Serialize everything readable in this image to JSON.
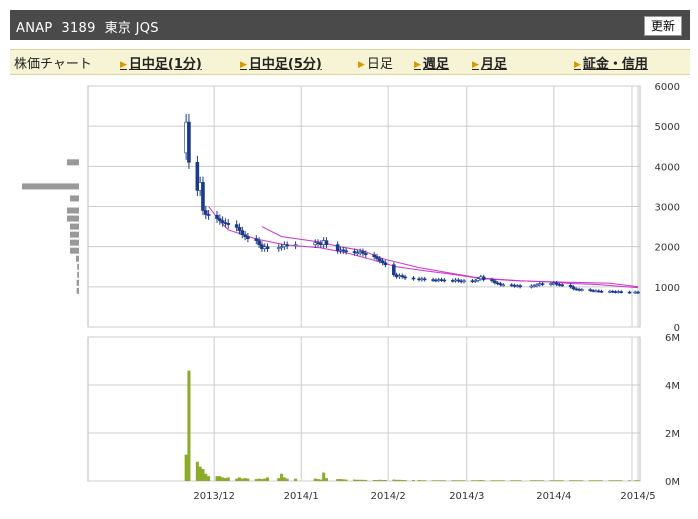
{
  "header": {
    "title": "ANAP  3189  東京 JQS",
    "refresh_label": "更新"
  },
  "nav": {
    "items": [
      {
        "label": "株価チャート",
        "link": false,
        "arrow": false
      },
      {
        "label": "日中足(1分)",
        "link": true,
        "arrow": true
      },
      {
        "label": "日中足(5分)",
        "link": true,
        "arrow": true
      },
      {
        "label": "日足",
        "link": false,
        "arrow": true
      },
      {
        "label": "週足",
        "link": true,
        "arrow": true
      },
      {
        "label": "月足",
        "link": true,
        "arrow": true
      },
      {
        "label": "証金・信用",
        "link": true,
        "arrow": true
      }
    ]
  },
  "colors": {
    "candle": "#1a3a8a",
    "ma": "#cc33cc",
    "volume": "#8aaa2a",
    "volume_profile": "#999999",
    "grid": "#cccccc"
  },
  "chart_data": [
    {
      "type": "candlestick",
      "ylim": [
        0,
        6000
      ],
      "yticks": [
        0,
        1000,
        2000,
        3000,
        4000,
        5000,
        6000
      ],
      "xticks": [
        "2013/12",
        "2014/1",
        "2014/2",
        "2014/3",
        "2014/4",
        "2014/5"
      ],
      "x_tick_dates": [
        "2013-12-01",
        "2014-01-01",
        "2014-02-01",
        "2014-03-01",
        "2014-04-01",
        "2014-05-01"
      ],
      "dates": [
        "2013-11-21",
        "2013-11-22",
        "2013-11-25",
        "2013-11-26",
        "2013-11-27",
        "2013-11-28",
        "2013-11-29",
        "2013-12-02",
        "2013-12-03",
        "2013-12-04",
        "2013-12-05",
        "2013-12-06",
        "2013-12-09",
        "2013-12-10",
        "2013-12-11",
        "2013-12-12",
        "2013-12-13",
        "2013-12-16",
        "2013-12-17",
        "2013-12-18",
        "2013-12-19",
        "2013-12-20",
        "2013-12-24",
        "2013-12-25",
        "2013-12-26",
        "2013-12-27",
        "2013-12-30",
        "2014-01-06",
        "2014-01-07",
        "2014-01-08",
        "2014-01-09",
        "2014-01-10",
        "2014-01-14",
        "2014-01-15",
        "2014-01-16",
        "2014-01-17",
        "2014-01-20",
        "2014-01-21",
        "2014-01-22",
        "2014-01-23",
        "2014-01-24",
        "2014-01-27",
        "2014-01-28",
        "2014-01-29",
        "2014-01-30",
        "2014-01-31",
        "2014-02-03",
        "2014-02-04",
        "2014-02-05",
        "2014-02-06",
        "2014-02-07",
        "2014-02-10",
        "2014-02-12",
        "2014-02-13",
        "2014-02-14",
        "2014-02-17",
        "2014-02-18",
        "2014-02-19",
        "2014-02-20",
        "2014-02-21",
        "2014-02-24",
        "2014-02-25",
        "2014-02-26",
        "2014-02-27",
        "2014-02-28",
        "2014-03-03",
        "2014-03-04",
        "2014-03-05",
        "2014-03-06",
        "2014-03-07",
        "2014-03-10",
        "2014-03-11",
        "2014-03-12",
        "2014-03-13",
        "2014-03-14",
        "2014-03-17",
        "2014-03-18",
        "2014-03-19",
        "2014-03-20",
        "2014-03-24",
        "2014-03-25",
        "2014-03-26",
        "2014-03-27",
        "2014-03-28",
        "2014-03-31",
        "2014-04-01",
        "2014-04-02",
        "2014-04-03",
        "2014-04-04",
        "2014-04-07",
        "2014-04-08",
        "2014-04-09",
        "2014-04-10",
        "2014-04-11",
        "2014-04-14",
        "2014-04-15",
        "2014-04-16",
        "2014-04-17",
        "2014-04-18",
        "2014-04-21",
        "2014-04-22",
        "2014-04-23",
        "2014-04-24",
        "2014-04-25",
        "2014-04-28",
        "2014-04-30",
        "2014-05-01"
      ],
      "close": [
        5100,
        4100,
        3400,
        3600,
        2900,
        2800,
        2780,
        2700,
        2650,
        2600,
        2580,
        2550,
        2480,
        2400,
        2300,
        2250,
        2200,
        2150,
        2050,
        1950,
        2000,
        1950,
        1980,
        2000,
        2050,
        2020,
        2050,
        2100,
        2080,
        2050,
        2150,
        2050,
        1900,
        1920,
        1900,
        1880,
        1850,
        1850,
        1880,
        1830,
        1800,
        1750,
        1700,
        1650,
        1600,
        1550,
        1300,
        1250,
        1280,
        1250,
        1220,
        1200,
        1180,
        1200,
        1180,
        1170,
        1160,
        1180,
        1170,
        1160,
        1150,
        1170,
        1150,
        1130,
        1150,
        1140,
        1160,
        1200,
        1250,
        1180,
        1150,
        1100,
        1080,
        1050,
        1050,
        1040,
        1020,
        1030,
        1000,
        1020,
        1030,
        1050,
        1080,
        1060,
        1080,
        1100,
        1060,
        1050,
        1040,
        1000,
        950,
        940,
        920,
        930,
        910,
        900,
        900,
        890,
        880,
        890,
        880,
        870,
        880,
        870,
        860,
        870,
        860
      ],
      "ma": {
        "name": "",
        "points": [
          [
            10,
            3000
          ],
          [
            15,
            2640
          ],
          [
            20,
            2420
          ],
          [
            30,
            2190
          ],
          [
            43,
            2050
          ],
          [
            53,
            1970
          ],
          [
            64,
            1850
          ],
          [
            75,
            1660
          ],
          [
            86,
            1500
          ],
          [
            97,
            1400
          ],
          [
            108,
            1310
          ],
          [
            118,
            1240
          ],
          [
            130,
            1190
          ],
          [
            141,
            1150
          ],
          [
            152,
            1120
          ],
          [
            163,
            1080
          ],
          [
            174,
            1060
          ],
          [
            183,
            1020
          ],
          [
            192,
            980
          ]
        ]
      },
      "ma_long": {
        "name": "",
        "points": [
          [
            34,
            2500
          ],
          [
            42,
            2250
          ],
          [
            50,
            2120
          ],
          [
            60,
            2000
          ],
          [
            70,
            1900
          ],
          [
            80,
            1700
          ],
          [
            95,
            1480
          ],
          [
            110,
            1320
          ],
          [
            125,
            1200
          ],
          [
            140,
            1150
          ],
          [
            155,
            1120
          ],
          [
            170,
            1100
          ],
          [
            180,
            1090
          ],
          [
            192,
            1000
          ]
        ]
      },
      "volume_profile": [
        {
          "price": 4100,
          "rel": 0.2
        },
        {
          "price": 3500,
          "rel": 0.95
        },
        {
          "price": 3200,
          "rel": 0.15
        },
        {
          "price": 2900,
          "rel": 0.2
        },
        {
          "price": 2700,
          "rel": 0.2
        },
        {
          "price": 2500,
          "rel": 0.15
        },
        {
          "price": 2300,
          "rel": 0.15
        },
        {
          "price": 2100,
          "rel": 0.15
        },
        {
          "price": 1900,
          "rel": 0.15
        },
        {
          "price": 1700,
          "rel": 0.05
        },
        {
          "price": 1500,
          "rel": 0.03
        },
        {
          "price": 1300,
          "rel": 0.03
        },
        {
          "price": 1100,
          "rel": 0.04
        },
        {
          "price": 900,
          "rel": 0.04
        }
      ]
    },
    {
      "type": "bar",
      "ylim": [
        0,
        6
      ],
      "yticks": [
        0,
        2,
        4,
        6
      ],
      "ytick_labels": [
        "0M",
        "2M",
        "4M",
        "6M"
      ],
      "volume_millions": [
        1.1,
        4.6,
        0.8,
        0.6,
        0.5,
        0.3,
        0.2,
        0.2,
        0.2,
        0.15,
        0.12,
        0.15,
        0.1,
        0.15,
        0.1,
        0.12,
        0.1,
        0.08,
        0.1,
        0.08,
        0.1,
        0.15,
        0.12,
        0.3,
        0.15,
        0.1,
        0.1,
        0.1,
        0.08,
        0.06,
        0.35,
        0.12,
        0.08,
        0.08,
        0.07,
        0.06,
        0.06,
        0.05,
        0.05,
        0.05,
        0.04,
        0.04,
        0.04,
        0.05,
        0.04,
        0.04,
        0.06,
        0.05,
        0.05,
        0.04,
        0.04,
        0.04,
        0.04,
        0.03,
        0.03,
        0.03,
        0.03,
        0.03,
        0.03,
        0.03,
        0.03,
        0.03,
        0.03,
        0.03,
        0.03,
        0.03,
        0.03,
        0.03,
        0.04,
        0.03,
        0.03,
        0.03,
        0.03,
        0.03,
        0.03,
        0.03,
        0.03,
        0.03,
        0.03,
        0.03,
        0.03,
        0.03,
        0.03,
        0.03,
        0.03,
        0.03,
        0.03,
        0.03,
        0.03,
        0.03,
        0.03,
        0.03,
        0.03,
        0.03,
        0.03,
        0.03,
        0.03,
        0.03,
        0.03,
        0.03,
        0.03,
        0.03,
        0.03,
        0.03,
        0.03,
        0.03,
        0.03
      ]
    }
  ]
}
